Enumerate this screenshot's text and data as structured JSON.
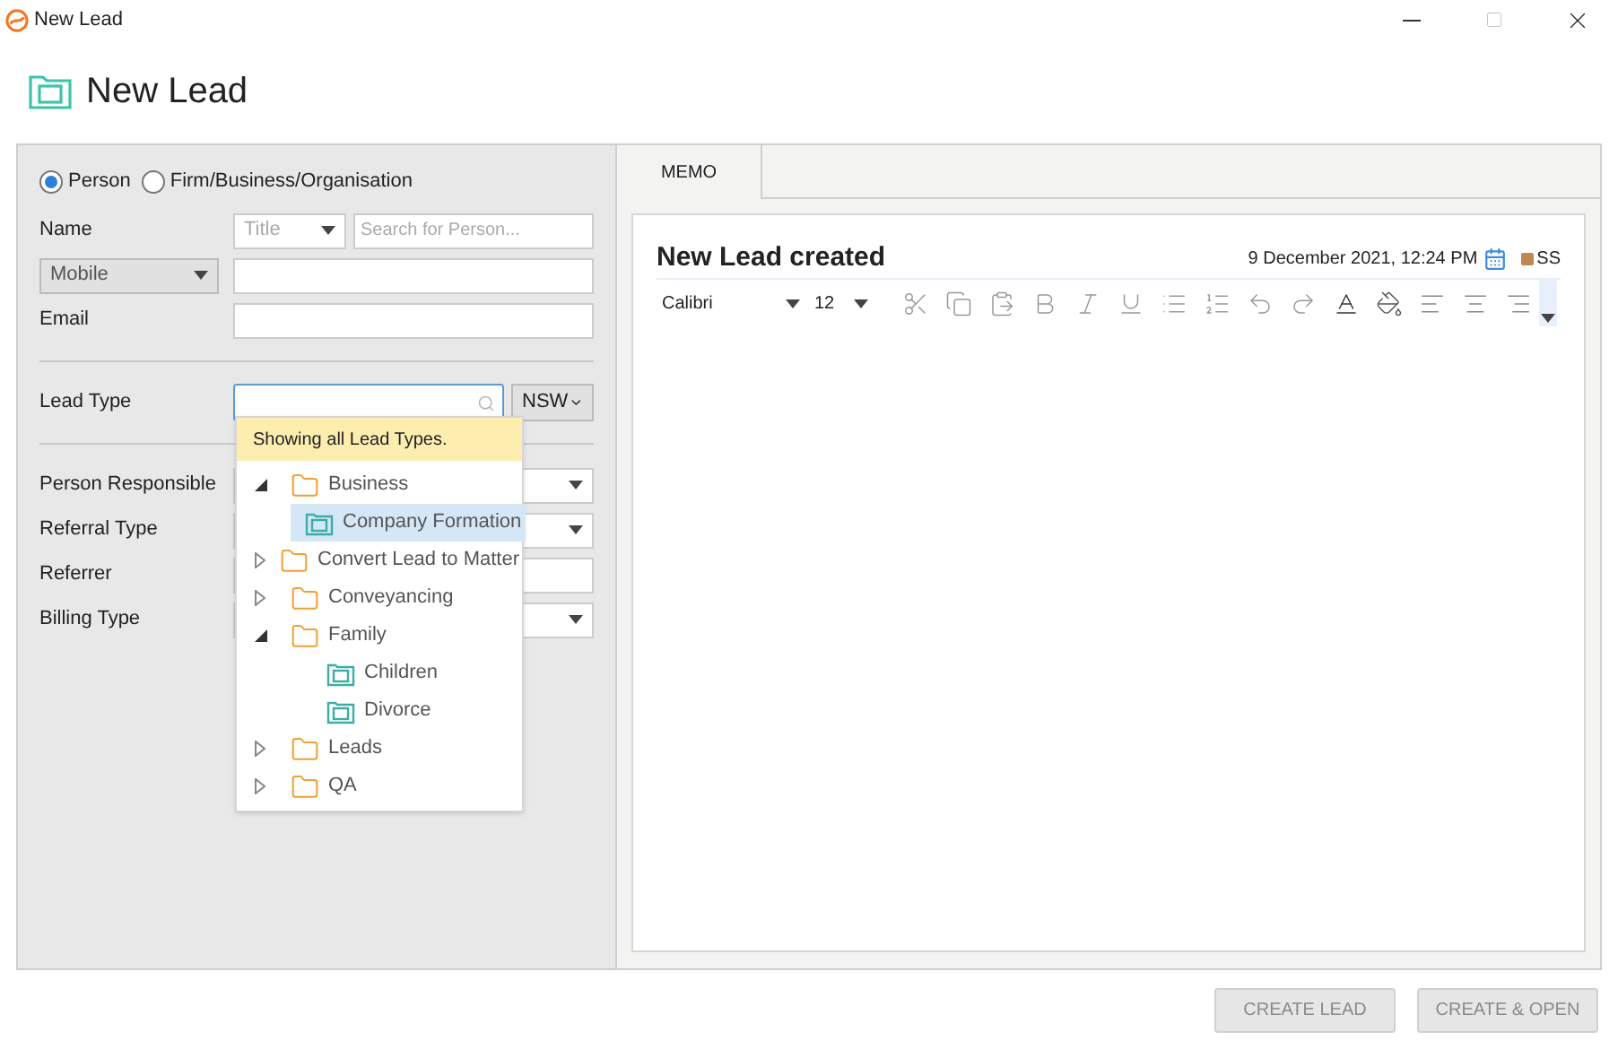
{
  "window": {
    "title": "New Lead"
  },
  "header": {
    "title": "New Lead"
  },
  "contact_kind": [
    {
      "label": "Person",
      "selected": true
    },
    {
      "label": "Firm/Business/Organisation",
      "selected": false
    }
  ],
  "name": {
    "label": "Name",
    "title_placeholder": "Title",
    "search_placeholder": "Search for Person..."
  },
  "phone": {
    "type": "Mobile"
  },
  "email": {
    "label": "Email"
  },
  "lead_type": {
    "label": "Lead Type",
    "state": "NSW"
  },
  "lead_type_dropdown": {
    "hint": "Showing all Lead Types.",
    "tree": [
      {
        "label": "Business",
        "kind": "folder",
        "expanded": true,
        "children": [
          {
            "label": "Company Formation",
            "kind": "lead",
            "selected": true
          }
        ]
      },
      {
        "label": "Convert Lead to Matter",
        "kind": "folder",
        "expanded": false
      },
      {
        "label": "Conveyancing",
        "kind": "folder",
        "expanded": false
      },
      {
        "label": "Family",
        "kind": "folder",
        "expanded": true,
        "children": [
          {
            "label": "Children",
            "kind": "lead",
            "selected": false
          },
          {
            "label": "Divorce",
            "kind": "lead",
            "selected": false
          }
        ]
      },
      {
        "label": "Leads",
        "kind": "folder",
        "expanded": false
      },
      {
        "label": "QA",
        "kind": "folder",
        "expanded": false
      }
    ]
  },
  "fields": [
    {
      "label": "Person Responsible",
      "kind": "select"
    },
    {
      "label": "Referral Type",
      "kind": "select"
    },
    {
      "label": "Referrer",
      "kind": "text"
    },
    {
      "label": "Billing Type",
      "kind": "select"
    }
  ],
  "tabs": [
    {
      "label": "MEMO",
      "selected": true
    }
  ],
  "memo": {
    "title": "New Lead created",
    "date": "9 December 2021, 12:24 PM",
    "author": "SS"
  },
  "toolbar": {
    "font": "Calibri",
    "size": "12"
  },
  "buttons": [
    {
      "label": "CREATE LEAD",
      "disabled": true
    },
    {
      "label": "CREATE & OPEN",
      "disabled": true
    }
  ]
}
